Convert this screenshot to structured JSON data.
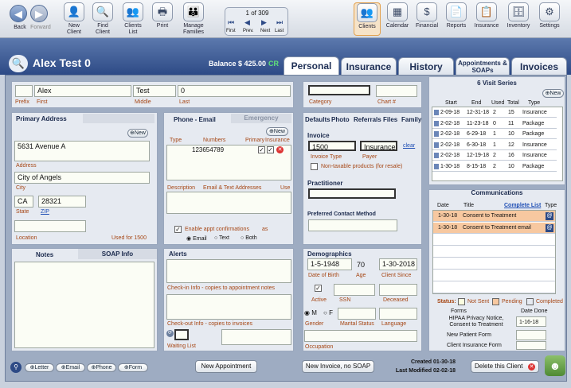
{
  "toolbar": {
    "back": "Back",
    "forward": "Forward",
    "new_client": "New Client",
    "find_client": "Find Client",
    "clients_list": "Clients List",
    "print": "Print",
    "manage_families": "Manage Families",
    "record": "1 of 309",
    "first": "First",
    "prev": "Prev.",
    "next": "Next",
    "last": "Last",
    "clients": "Clients",
    "calendar": "Calendar",
    "financial": "Financial",
    "reports": "Reports",
    "insurance": "Insurance",
    "inventory": "Inventory",
    "settings": "Settings"
  },
  "header": {
    "client_name": "Alex Test 0",
    "balance_label": "Balance $ 425.00",
    "balance_suffix": "CR"
  },
  "tabs": [
    "Personal",
    "Insurance",
    "History",
    "Appointments & SOAPs",
    "Invoices"
  ],
  "name": {
    "prefix": "",
    "first": "Alex",
    "middle": "Test",
    "last": "0",
    "prefix_lbl": "Prefix",
    "first_lbl": "First",
    "middle_lbl": "Middle",
    "last_lbl": "Last"
  },
  "category": {
    "label": "Category",
    "chart_label": "Chart #",
    "value": "",
    "chart": ""
  },
  "address": {
    "title": "Primary Address",
    "new": "New",
    "line1": "5631 Avenue A",
    "address_lbl": "Address",
    "city": "City of Angels",
    "city_lbl": "City",
    "state": "CA",
    "zip": "28321",
    "state_lbl": "State",
    "zip_lbl": "ZIP",
    "location_lbl": "Location",
    "used_for": "Used for 1500"
  },
  "phone": {
    "tab1": "Phone - Email",
    "tab2": "Emergency",
    "new": "New",
    "type_lbl": "Type",
    "numbers_lbl": "Numbers",
    "primary_lbl": "Primary",
    "insurance_lbl": "Insurance",
    "number": "123654789",
    "desc_lbl": "Description",
    "email_lbl": "Email & Text Addresses",
    "use_lbl": "Use",
    "enable_confirm": "Enable appt confirmations",
    "as_lbl": "as",
    "opt_email": "Email",
    "opt_text": "Text",
    "opt_both": "Both"
  },
  "defaults": {
    "tabs": [
      "Defaults",
      "Photo",
      "Referrals",
      "Files",
      "Family"
    ],
    "invoice_lbl": "Invoice",
    "invoice_type": "1500",
    "payer": "Insurance",
    "clear": "clear",
    "invoice_type_lbl": "Invoice Type",
    "payer_lbl": "Payer",
    "nontax": "Non-taxable products (for resale)",
    "practitioner_lbl": "Practitioner",
    "contact_lbl": "Preferred Contact Method"
  },
  "notes": {
    "tab1": "Notes",
    "tab2": "SOAP Info"
  },
  "alerts": {
    "title": "Alerts",
    "checkin": "Check-in Info - copies to appointment notes",
    "checkout": "Check-out Info - copies to invoices",
    "waiting": "Waiting List"
  },
  "demographics": {
    "title": "Demographics",
    "dob": "1-5-1948",
    "age": "70",
    "client_since": "1-30-2018",
    "dob_lbl": "Date of Birth",
    "age_lbl": "Age",
    "since_lbl": "Client Since",
    "active_lbl": "Active",
    "ssn_lbl": "SSN",
    "deceased_lbl": "Deceased",
    "m": "M",
    "f": "F",
    "gender_lbl": "Gender",
    "marital_lbl": "Marital Status",
    "language_lbl": "Language",
    "occupation_lbl": "Occupation"
  },
  "visits": {
    "title": "6 Visit Series",
    "new": "New",
    "headers": [
      "Start",
      "End",
      "Used",
      "Total",
      "Type"
    ],
    "rows": [
      [
        "2-09-18",
        "12-31-18",
        "2",
        "15",
        "Insurance"
      ],
      [
        "2-02-18",
        "11-23-18",
        "0",
        "11",
        "Package"
      ],
      [
        "2-02-18",
        "6-29-18",
        "1",
        "10",
        "Package"
      ],
      [
        "2-02-18",
        "6-30-18",
        "1",
        "12",
        "Insurance"
      ],
      [
        "2-02-18",
        "12-19-18",
        "2",
        "16",
        "Insurance"
      ],
      [
        "1-30-18",
        "8-15-18",
        "2",
        "10",
        "Package"
      ]
    ]
  },
  "comms": {
    "title": "Communications",
    "headers": [
      "Date",
      "Title",
      "Complete List",
      "Type"
    ],
    "rows": [
      [
        "1-30-18",
        "Consent to Treatment"
      ],
      [
        "1-30-18",
        "Consent to Treatment email"
      ]
    ],
    "status_lbl": "Status:",
    "not_sent": "Not Sent",
    "pending": "Pending",
    "completed": "Completed",
    "forms_lbl": "Forms",
    "date_done_lbl": "Date Done",
    "forms": [
      [
        "HIPAA Privacy Notice, Consent to Treatment",
        "1-16-18"
      ],
      [
        "New Patient Form",
        ""
      ],
      [
        "Client Insurance Form",
        ""
      ]
    ]
  },
  "footer": {
    "letter": "Letter",
    "email": "Email",
    "phone": "Phone",
    "form": "Form",
    "new_appt": "New Appointment",
    "new_invoice": "New Invoice, no SOAP",
    "created": "Created 01-30-18",
    "modified": "Last Modified 02-02-18",
    "delete": "Delete this Client"
  },
  "colors": {
    "accent": "#2d4a86",
    "label": "#a64614",
    "pending": "#f7c8a0",
    "field": "#fbfdf5"
  }
}
